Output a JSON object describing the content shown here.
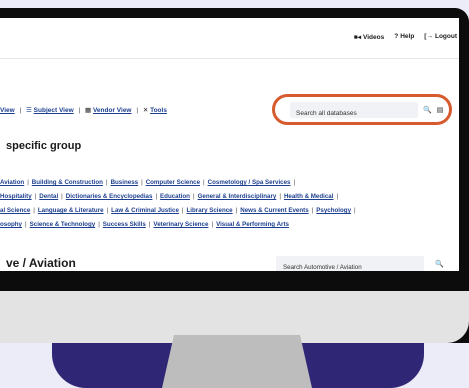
{
  "topbar": {
    "links": [
      {
        "icon": "video-icon",
        "glyph": "■◂",
        "label": "Videos"
      },
      {
        "icon": "help-icon",
        "glyph": "?",
        "label": "Help"
      },
      {
        "icon": "logout-icon",
        "glyph": "[→",
        "label": "Logout"
      }
    ]
  },
  "views": {
    "items": [
      {
        "label": "View"
      },
      {
        "icon": "list-icon",
        "glyph": "☰",
        "label": "Subject View"
      },
      {
        "icon": "vendor-icon",
        "glyph": "▦",
        "label": "Vendor View"
      },
      {
        "icon": "tools-icon",
        "glyph": "✕",
        "label": "Tools"
      }
    ]
  },
  "search": {
    "placeholder": "Search all databases",
    "search_icon": "🔍",
    "list_icon": "▤"
  },
  "heading": "specific group",
  "categories": [
    [
      "Aviation",
      "Building & Construction",
      "Business",
      "Computer Science",
      "Cosmetology / Spa Services"
    ],
    [
      "Hospitality",
      "Dental",
      "Dictionaries & Encyclopedias",
      "Education",
      "General & Interdisciplinary",
      "Health & Medical"
    ],
    [
      "al Science",
      "Language & Literature",
      "Law & Criminal Justice",
      "Library Science",
      "News & Current Events",
      "Psychology"
    ],
    [
      "osophy",
      "Science & Technology",
      "Success Skills",
      "Veterinary Science",
      "Visual & Performing Arts"
    ]
  ],
  "section": {
    "title": "ve / Aviation",
    "search_placeholder": "Search Automotive / Aviation",
    "search_icon": "🔍"
  }
}
